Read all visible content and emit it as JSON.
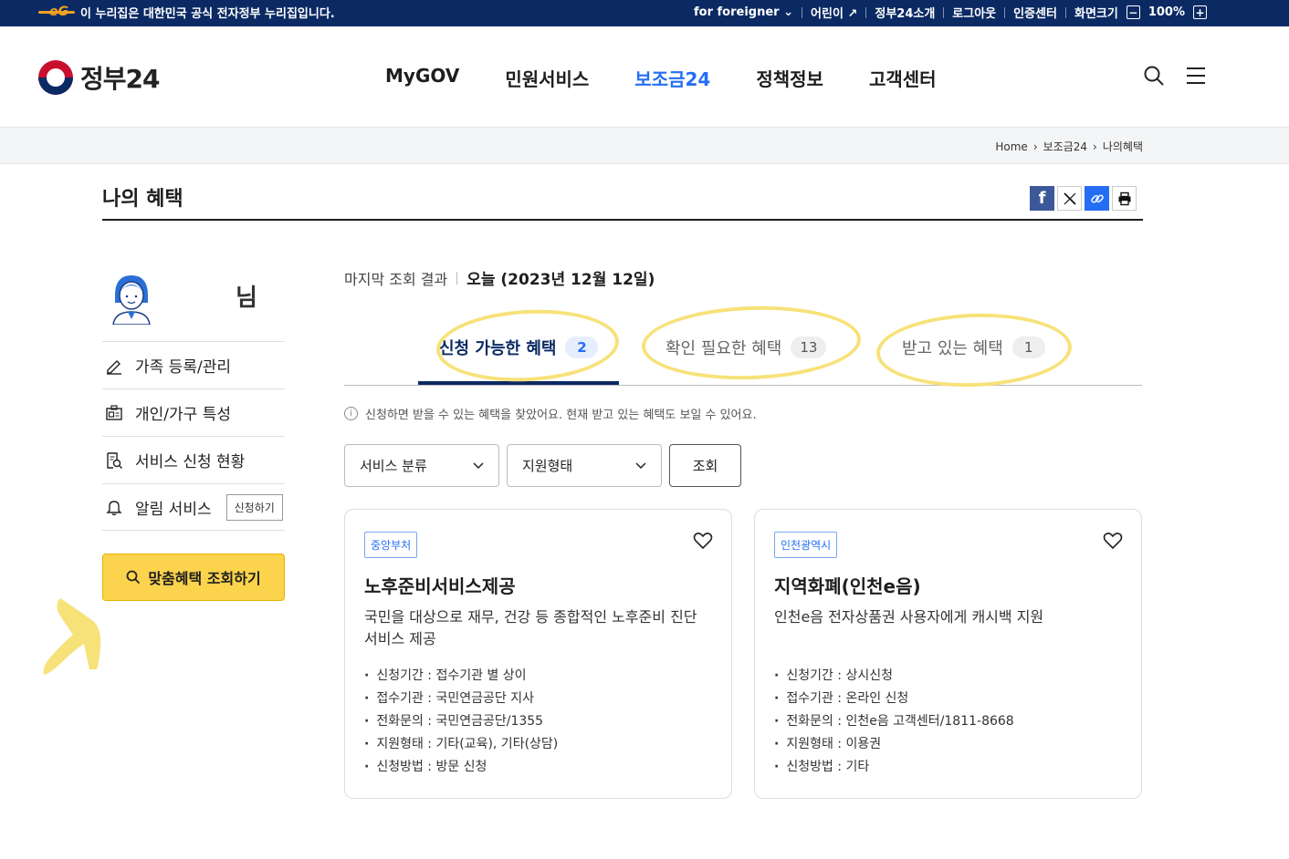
{
  "topbar": {
    "gov_notice": "이 누리집은 대한민국 공식 전자정부 누리집입니다.",
    "for_foreigner": "for foreigner",
    "kids": "어린이",
    "about": "정부24소개",
    "logout": "로그아웃",
    "cert": "인증센터",
    "screen_size": "화면크기",
    "zoom_minus": "−",
    "zoom_level": "100%",
    "zoom_plus": "+"
  },
  "header": {
    "logo": "정부24",
    "nav": [
      "MyGOV",
      "민원서비스",
      "보조금24",
      "정책정보",
      "고객센터"
    ],
    "active_nav": "보조금24"
  },
  "breadcrumb": [
    "Home",
    "보조금24",
    "나의혜택"
  ],
  "page": {
    "title": "나의 혜택"
  },
  "user": {
    "suffix": "님"
  },
  "sidebar": {
    "items": [
      {
        "label": "가족 등록/관리",
        "icon": "pencil-icon"
      },
      {
        "label": "개인/가구 특성",
        "icon": "id-card-icon"
      },
      {
        "label": "서비스 신청 현황",
        "icon": "document-search-icon"
      },
      {
        "label": "알림 서비스",
        "icon": "bell-icon",
        "button": "신청하기"
      }
    ],
    "cta": "맞춤혜택 조회하기"
  },
  "main": {
    "last_query_label": "마지막 조회 결과",
    "last_query_value": "오늘 (2023년 12월 12일)",
    "tabs": [
      {
        "label": "신청 가능한 혜택",
        "count": "2"
      },
      {
        "label": "확인 필요한 혜택",
        "count": "13"
      },
      {
        "label": "받고 있는 혜택",
        "count": "1"
      }
    ],
    "notice": "신청하면 받을 수 있는 혜택을 찾았어요. 현재 받고 있는 혜택도 보일 수 있어요.",
    "filter_category": "서비스 분류",
    "filter_type": "지원형태",
    "search_button": "조회"
  },
  "cards": [
    {
      "badge": "중앙부처",
      "title": "노후준비서비스제공",
      "desc": "국민을 대상으로 재무, 건강 등 종합적인 노후준비 진단 서비스 제공",
      "details": [
        "신청기간 : 접수기관 별 상이",
        "접수기관 : 국민연금공단 지사",
        "전화문의 : 국민연금공단/1355",
        "지원형태 : 기타(교육), 기타(상담)",
        "신청방법 : 방문 신청"
      ]
    },
    {
      "badge": "인천광역시",
      "title": "지역화폐(인천e음)",
      "desc": "인천e음 전자상품권 사용자에게 캐시백 지원",
      "details": [
        "신청기간 : 상시신청",
        "접수기관 : 온라인 신청",
        "전화문의 : 인천e음 고객센터/1811-8668",
        "지원형태 : 이용권",
        "신청방법 : 기타"
      ]
    }
  ],
  "colors": {
    "navy": "#0b2a63",
    "accent_blue": "#256ef4",
    "cta_yellow": "#fcd34d",
    "highlight": "#f7e27a"
  }
}
